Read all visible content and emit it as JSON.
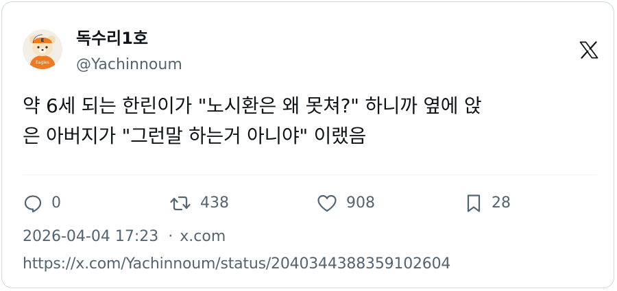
{
  "author": {
    "display_name": "독수리1호",
    "handle": "@Yachinnoum",
    "avatar_icon": "bear-avatar-icon"
  },
  "platform_icon": "x-logo-icon",
  "tweet": {
    "line1": "약 6세 되는 한린이가 \"노시환은 왜 못쳐?\" 하니까 옆에 앉",
    "line2": "은 아버지가 \"그런말 하는거 아니야\" 이랬음"
  },
  "actions": {
    "reply_count": "0",
    "retweet_count": "438",
    "like_count": "908",
    "bookmark_count": "28"
  },
  "meta": {
    "timestamp": "2026-04-04 17:23",
    "separator": "·",
    "site": "x.com"
  },
  "url": "https://x.com/Yachinnoum/status/2040344388359102604",
  "colors": {
    "text": "#0f1419",
    "secondary": "#536471",
    "border": "#cfd9de",
    "avatar_shirt": "#f07a22"
  }
}
